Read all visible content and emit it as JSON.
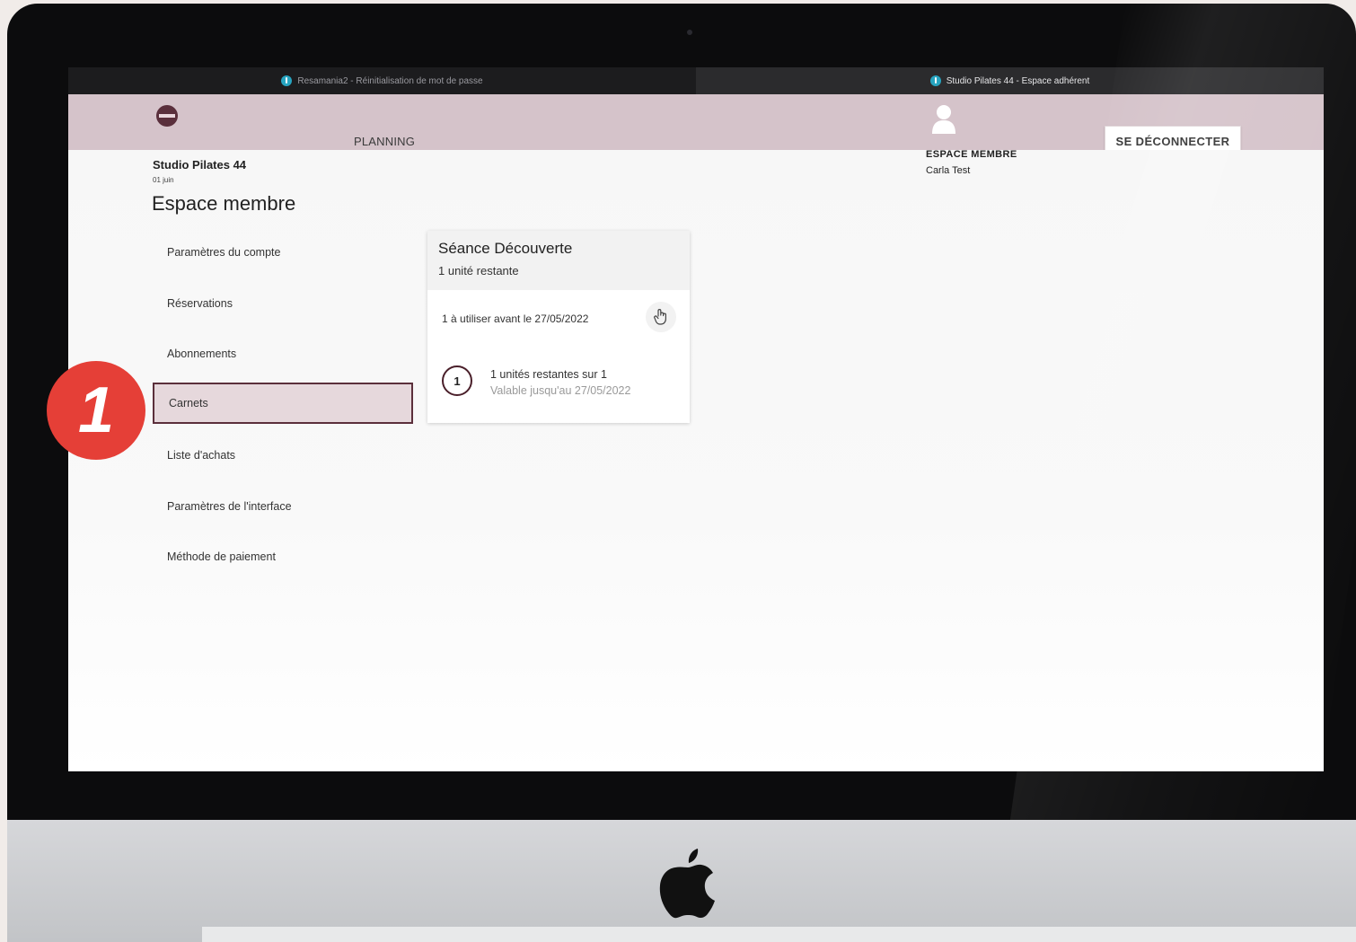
{
  "browser": {
    "tabs": [
      {
        "label": "Resamania2 - Réinitialisation de mot de passe",
        "active": false
      },
      {
        "label": "Studio Pilates 44 - Espace adhérent",
        "active": true
      }
    ]
  },
  "header": {
    "nav_planning": "PLANNING",
    "logout_label": "SE DÉCONNECTER",
    "member_area_label": "ESPACE MEMBRE",
    "user_name": "Carla Test",
    "brand_color": "#d5c3ca",
    "accent_color": "#5b2f3b"
  },
  "studio": {
    "name": "Studio Pilates 44",
    "date": "01 juin"
  },
  "page": {
    "title": "Espace membre"
  },
  "sidebar": {
    "items": [
      {
        "label": "Paramètres du compte",
        "active": false
      },
      {
        "label": "Réservations",
        "active": false
      },
      {
        "label": "Abonnements",
        "active": false
      },
      {
        "label": "Carnets",
        "active": true
      },
      {
        "label": "Liste d'achats",
        "active": false
      },
      {
        "label": "Paramètres de l'interface",
        "active": false
      },
      {
        "label": "Méthode de paiement",
        "active": false
      }
    ]
  },
  "card": {
    "title": "Séance Découverte",
    "subtitle": "1 unité restante",
    "deadline": "1 à utiliser avant le 27/05/2022",
    "count": "1",
    "units_text": "1 unités restantes sur 1",
    "valid_text": "Valable jusqu'au 27/05/2022",
    "action_icon": "pointing-hand-icon"
  },
  "annotation": {
    "step_number": "1",
    "color": "#e53f37"
  }
}
